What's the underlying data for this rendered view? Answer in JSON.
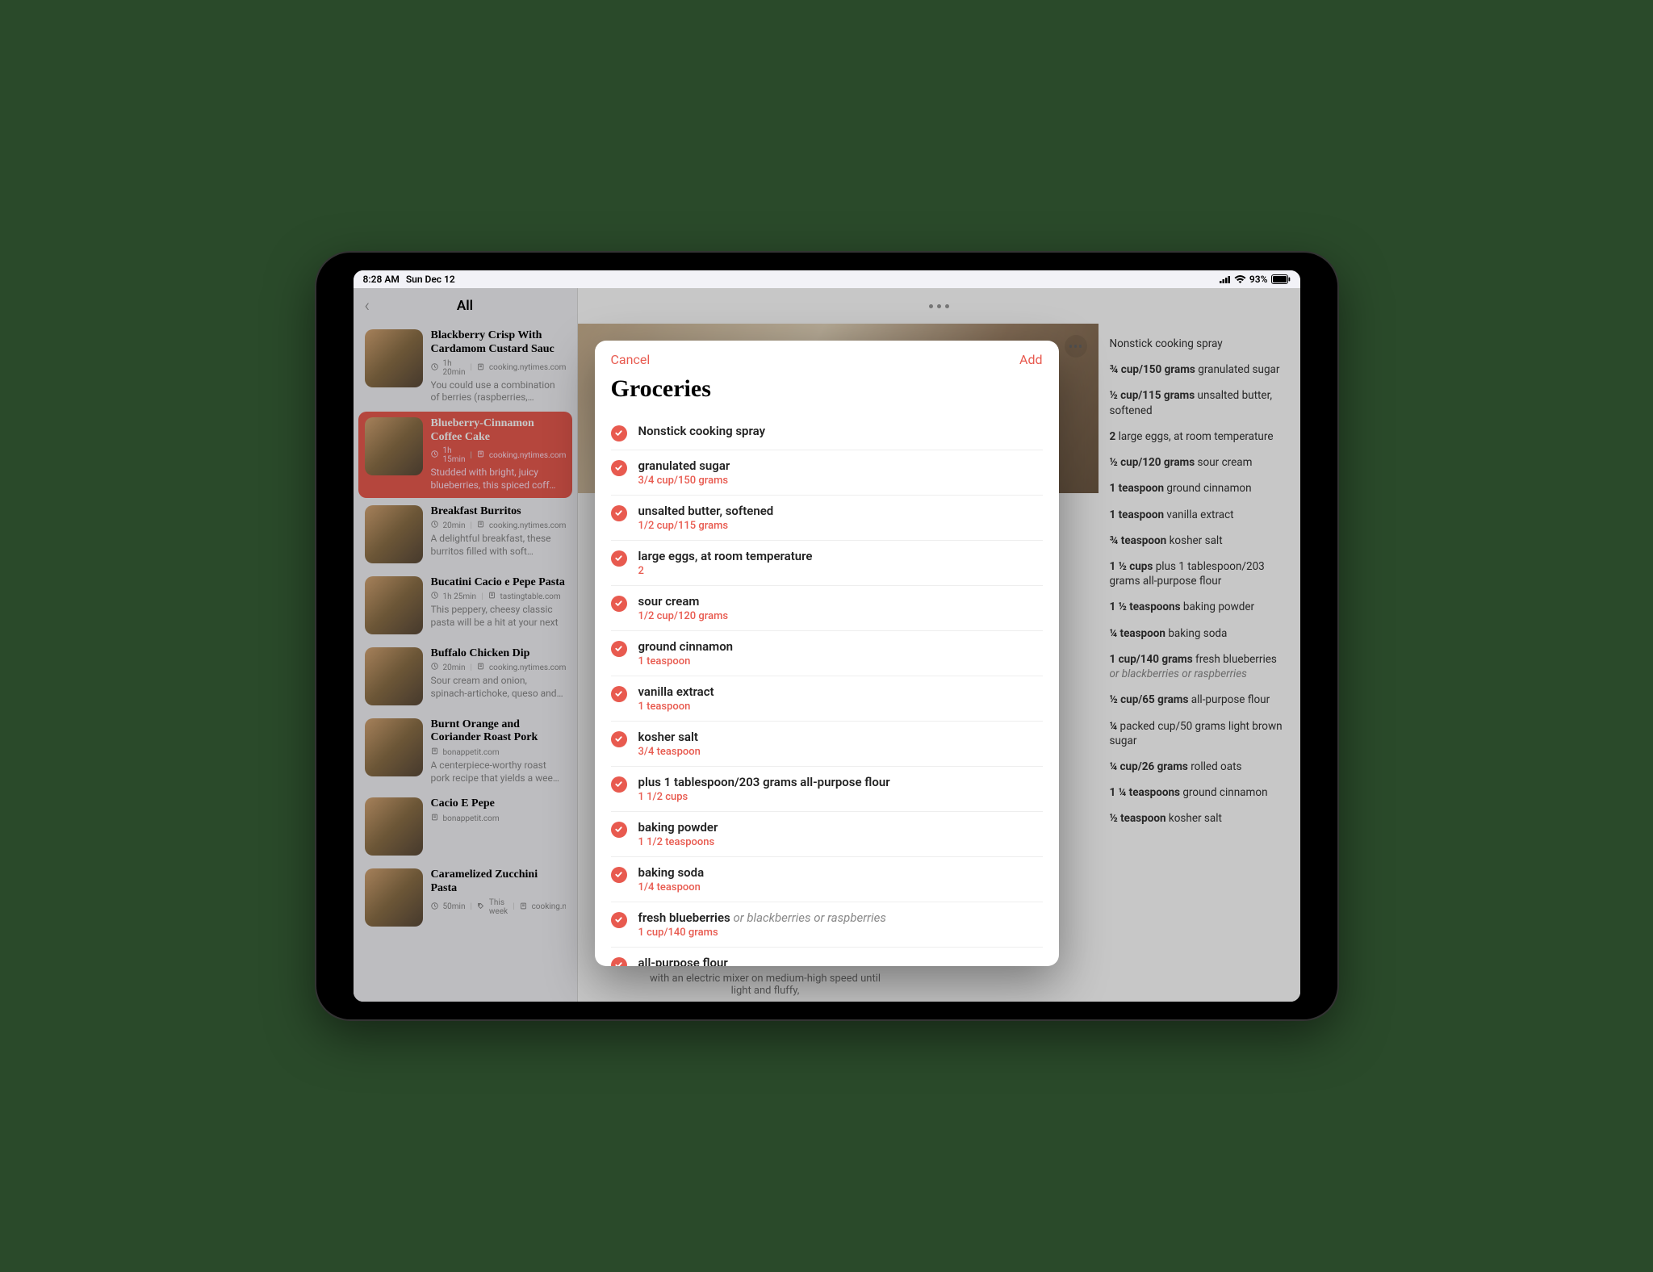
{
  "status": {
    "time": "8:28 AM",
    "date": "Sun Dec 12",
    "battery": "93%"
  },
  "sidebar": {
    "title": "All",
    "recipes": [
      {
        "title": "Blackberry Crisp With Cardamom Custard Sauc",
        "time": "1h 20min",
        "source": "cooking.nytimes.com",
        "desc": "You could use a combination of berries (raspberries,…",
        "selected": false
      },
      {
        "title": "Blueberry-Cinnamon Coffee Cake",
        "time": "1h 15min",
        "source": "cooking.nytimes.com",
        "desc": "Studded with bright, juicy blueberries, this spiced coff…",
        "selected": true
      },
      {
        "title": "Breakfast Burritos",
        "time": "20min",
        "source": "cooking.nytimes.com",
        "desc": "A delightful breakfast, these burritos filled with soft…",
        "selected": false
      },
      {
        "title": "Bucatini Cacio e Pepe Pasta",
        "time": "1h 25min",
        "source": "tastingtable.com",
        "desc": "This peppery, cheesy classic pasta will be a hit at your next",
        "selected": false
      },
      {
        "title": "Buffalo Chicken Dip",
        "time": "20min",
        "source": "cooking.nytimes.com",
        "desc": "Sour cream and onion, spinach-artichoke, queso and…",
        "selected": false
      },
      {
        "title": "Burnt Orange and Coriander Roast Pork",
        "time": "",
        "source": "bonappetit.com",
        "desc": "A centerpiece-worthy roast pork recipe that yields a wee…",
        "selected": false
      },
      {
        "title": "Cacio E Pepe",
        "time": "",
        "source": "bonappetit.com",
        "desc": "",
        "selected": false
      },
      {
        "title": "Caramelized Zucchini Pasta",
        "time": "50min",
        "source": "cooking.n…",
        "desc": "",
        "tag": "This week",
        "selected": false
      }
    ]
  },
  "detail": {
    "ingredients": [
      {
        "measure": "",
        "name": "Nonstick cooking spray"
      },
      {
        "measure": "¾ cup/150 grams",
        "name": "granulated sugar"
      },
      {
        "measure": "½ cup/115 grams",
        "name": "unsalted butter, softened"
      },
      {
        "measure": "2",
        "name": "large eggs, at room temperature"
      },
      {
        "measure": "½ cup/120 grams",
        "name": "sour cream"
      },
      {
        "measure": "1 teaspoon",
        "name": "ground cinnamon"
      },
      {
        "measure": "1 teaspoon",
        "name": "vanilla extract"
      },
      {
        "measure": "¾ teaspoon",
        "name": "kosher salt"
      },
      {
        "measure": "1 ½ cups",
        "name": "plus 1 tablespoon/203 grams all-purpose flour"
      },
      {
        "measure": "1 ½ teaspoons",
        "name": "baking powder"
      },
      {
        "measure": "¼ teaspoon",
        "name": "baking soda"
      },
      {
        "measure": "1 cup/140 grams",
        "name": "fresh blueberries",
        "alt": "or blackberries or raspberries"
      },
      {
        "measure": "½ cup/65 grams",
        "name": "all-purpose flour"
      },
      {
        "measure": "¼",
        "name": "packed cup/50 grams light brown sugar"
      },
      {
        "measure": "¼ cup/26 grams",
        "name": "rolled oats"
      },
      {
        "measure": "1 ¼ teaspoons",
        "name": "ground cinnamon"
      },
      {
        "measure": "½ teaspoon",
        "name": "kosher salt"
      }
    ],
    "instruction_snippet": "with an electric mixer on medium-high speed until light and fluffy,"
  },
  "modal": {
    "cancel": "Cancel",
    "add": "Add",
    "title": "Groceries",
    "items": [
      {
        "name": "Nonstick cooking spray",
        "qty": ""
      },
      {
        "name": "granulated sugar",
        "qty": "3/4 cup/150 grams"
      },
      {
        "name": "unsalted butter, softened",
        "qty": "1/2 cup/115 grams"
      },
      {
        "name": "large eggs, at room temperature",
        "qty": "2"
      },
      {
        "name": "sour cream",
        "qty": "1/2 cup/120 grams"
      },
      {
        "name": "ground cinnamon",
        "qty": "1 teaspoon"
      },
      {
        "name": "vanilla extract",
        "qty": "1 teaspoon"
      },
      {
        "name": "kosher salt",
        "qty": "3/4 teaspoon"
      },
      {
        "name": "plus 1 tablespoon/203 grams all-purpose flour",
        "qty": "1 1/2 cups"
      },
      {
        "name": "baking powder",
        "qty": "1 1/2 teaspoons"
      },
      {
        "name": "baking soda",
        "qty": "1/4 teaspoon"
      },
      {
        "name": "fresh blueberries",
        "alt": "or blackberries or raspberries",
        "qty": "1 cup/140 grams"
      },
      {
        "name": "all-purpose flour",
        "qty": ""
      }
    ]
  }
}
